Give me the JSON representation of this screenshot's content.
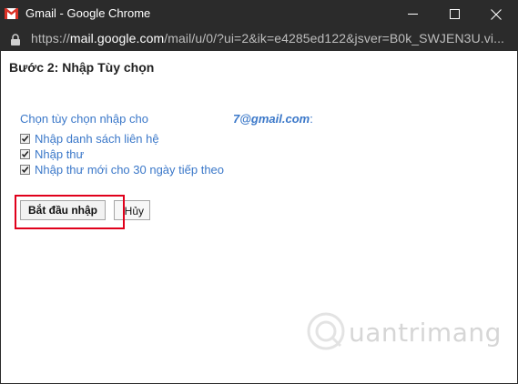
{
  "window": {
    "title": "Gmail - Google Chrome",
    "icon": "gmail-icon"
  },
  "address_bar": {
    "scheme": "https://",
    "host": "mail.google.com",
    "path": "/mail/u/0/?ui=2&ik=e4285ed122&jsver=B0k_SWJEN3U.vi..."
  },
  "dialog": {
    "title": "Bước 2: Nhập Tùy chọn",
    "choose_label": "Chọn tùy chọn nhập cho",
    "email_visible": "7@gmail.com",
    "email_suffix": ":",
    "options": [
      {
        "label": "Nhập danh sách liên hệ",
        "checked": true
      },
      {
        "label": "Nhập thư",
        "checked": true
      },
      {
        "label": "Nhập thư mới cho 30 ngày tiếp theo",
        "checked": true
      }
    ],
    "start_button": "Bắt đầu nhập",
    "cancel_button": "Hủy"
  },
  "annotation": {
    "highlight_color": "#e0001b"
  },
  "colors": {
    "link_blue": "#3b78c9",
    "titlebar_bg": "#2b2b2b"
  }
}
